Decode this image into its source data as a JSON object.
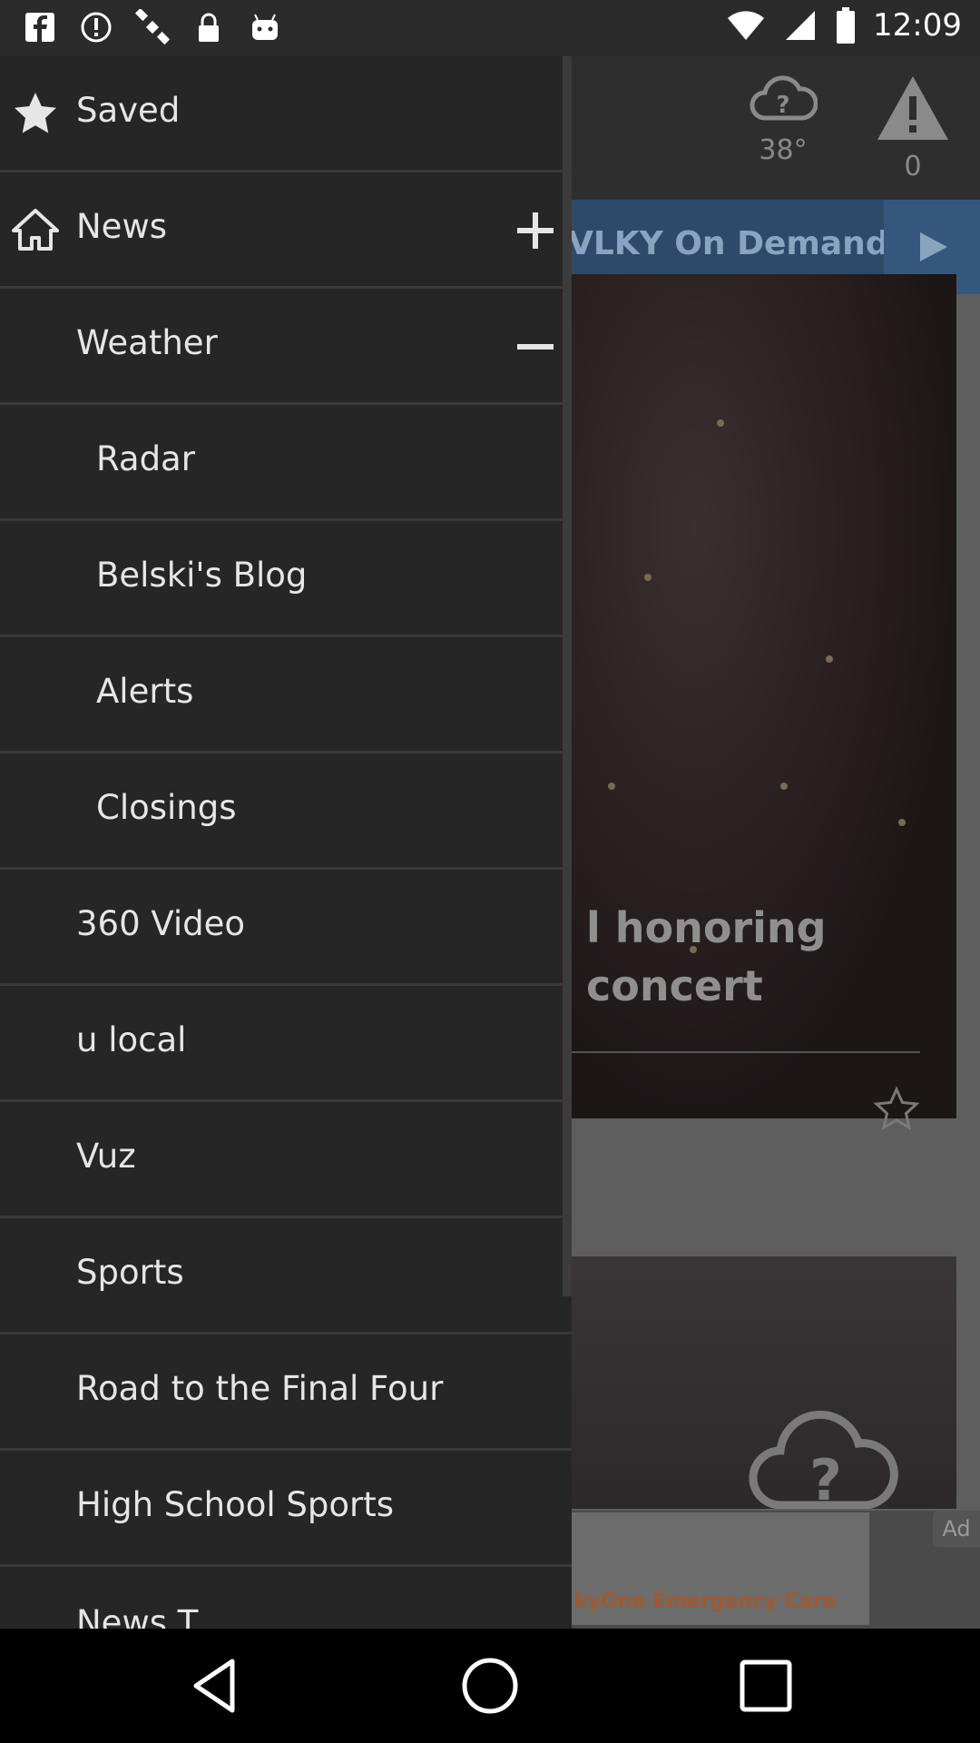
{
  "status_bar": {
    "time": "12:09",
    "left_icons": [
      "facebook-icon",
      "fake-gps-icon",
      "satellite-icon",
      "lock-icon",
      "android-icon"
    ],
    "right_icons": [
      "wifi-icon",
      "signal-icon",
      "battery-icon"
    ]
  },
  "app_header": {
    "weather_temp": "38°",
    "alerts_count": "0"
  },
  "on_demand": {
    "label": "VLKY On Demand"
  },
  "story": {
    "headline": "l honoring concert"
  },
  "ad": {
    "text": "ckyOne Emergency Care",
    "tag": "Ad"
  },
  "drawer": {
    "items": [
      {
        "label": "Saved",
        "icon": "star-icon"
      },
      {
        "label": "News",
        "icon": "home-icon",
        "expander": "plus"
      },
      {
        "label": "Weather",
        "expander": "minus"
      },
      {
        "label": "Radar",
        "sub": true
      },
      {
        "label": "Belski's Blog",
        "sub": true
      },
      {
        "label": "Alerts",
        "sub": true
      },
      {
        "label": "Closings",
        "sub": true
      },
      {
        "label": "360 Video"
      },
      {
        "label": "u local"
      },
      {
        "label": "Vuz"
      },
      {
        "label": "Sports"
      },
      {
        "label": "Road to the Final Four"
      },
      {
        "label": "High School Sports"
      },
      {
        "label": "News T"
      }
    ]
  },
  "nav_bar": {
    "buttons": [
      "back-icon",
      "home-circle-icon",
      "recents-icon"
    ]
  },
  "colors": {
    "drawer_bg": "#262626",
    "accent_blue": "#2e4a6b",
    "text": "#e6e6e6"
  }
}
